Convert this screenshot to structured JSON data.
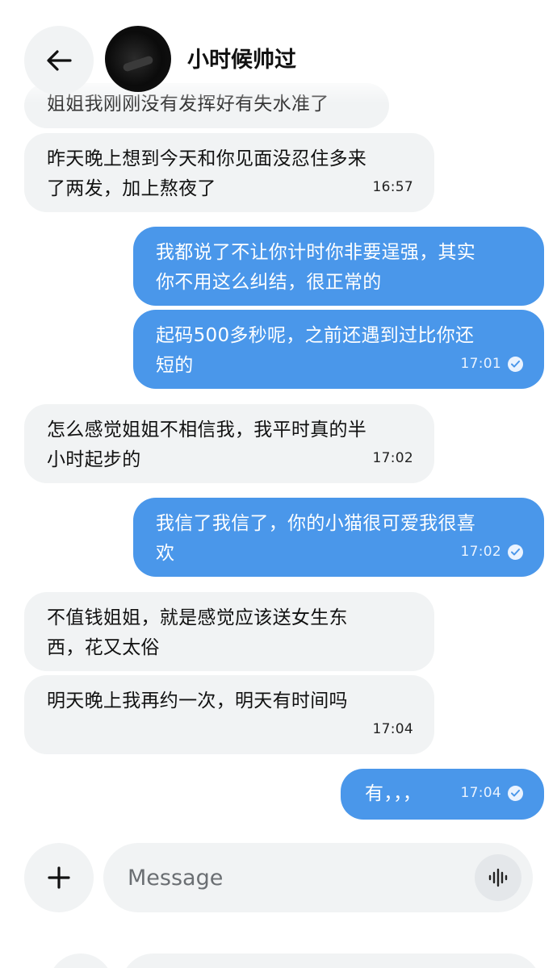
{
  "header": {
    "contact_name": "小时候帅过",
    "back_icon": "arrow-left-icon"
  },
  "messages": [
    {
      "dir": "in",
      "lines": [
        "姐姐我刚刚没有发挥好有失水准了"
      ],
      "time": ""
    },
    {
      "dir": "in",
      "lines": [
        "昨天晚上想到今天和你见面没忍住多来",
        "了两发，加上熬夜了"
      ],
      "time": "16:57"
    },
    {
      "dir": "out",
      "lines": [
        "我都说了不让你计时你非要逞强，其实",
        "你不用这么纠结，很正常的"
      ],
      "time": ""
    },
    {
      "dir": "out",
      "lines": [
        "起码500多秒呢，之前还遇到过比你还",
        "短的"
      ],
      "time": "17:01",
      "read": true
    },
    {
      "dir": "in",
      "lines": [
        "怎么感觉姐姐不相信我，我平时真的半",
        "小时起步的"
      ],
      "time": "17:02"
    },
    {
      "dir": "out",
      "lines": [
        "我信了我信了，你的小猫很可爱我很喜",
        "欢"
      ],
      "time": "17:02",
      "read": true
    },
    {
      "dir": "in",
      "lines": [
        "不值钱姐姐，就是感觉应该送女生东",
        "西，花又太俗"
      ],
      "time": ""
    },
    {
      "dir": "in",
      "lines": [
        "明天晚上我再约一次，明天有时间吗"
      ],
      "time": "17:04"
    },
    {
      "dir": "out",
      "lines": [
        "有，，，"
      ],
      "time": "17:04",
      "read": true
    }
  ],
  "composer": {
    "placeholder": "Message",
    "add_icon": "plus-icon",
    "voice_icon": "waveform-icon"
  },
  "colors": {
    "outgoing_bubble": "#4a97ea",
    "incoming_bubble": "#f1f3f4"
  }
}
